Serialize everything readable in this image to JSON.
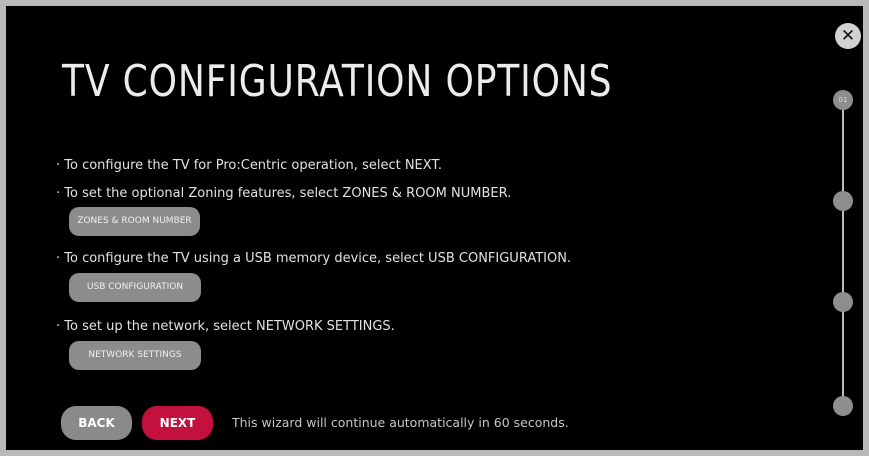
{
  "page": {
    "title": "TV CONFIGURATION OPTIONS"
  },
  "instructions": [
    "· To configure the TV for Pro:Centric operation, select NEXT.",
    "· To set the optional Zoning features, select ZONES & ROOM NUMBER.",
    "· To configure the TV using a USB memory device, select USB CONFIGURATION.",
    "· To set up the network, select NETWORK SETTINGS."
  ],
  "options": {
    "zones_label": "ZONES & ROOM NUMBER",
    "usb_label": "USB CONFIGURATION",
    "network_label": "NETWORK SETTINGS"
  },
  "footer": {
    "back_label": "BACK",
    "next_label": "NEXT",
    "auto_message": "This wizard will continue automatically in 60 seconds."
  },
  "close": {
    "glyph": "✕"
  },
  "stepper": {
    "current_step_label": "01",
    "total_steps": 4
  },
  "colors": {
    "next_accent": "#c4103c",
    "background": "#000000"
  }
}
